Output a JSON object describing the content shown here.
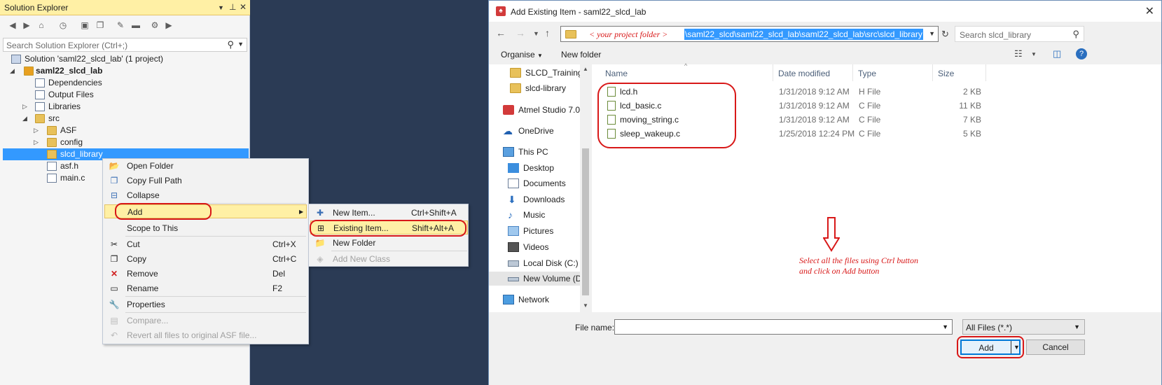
{
  "solution_explorer": {
    "title": "Solution Explorer",
    "search_placeholder": "Search Solution Explorer (Ctrl+;)",
    "tree": [
      {
        "label": "Solution 'saml22_slcd_lab' (1 project)"
      },
      {
        "label": "saml22_slcd_lab"
      },
      {
        "label": "Dependencies"
      },
      {
        "label": "Output Files"
      },
      {
        "label": "Libraries"
      },
      {
        "label": "src"
      },
      {
        "label": "ASF"
      },
      {
        "label": "config"
      },
      {
        "label": "slcd_library"
      },
      {
        "label": "asf.h"
      },
      {
        "label": "main.c"
      }
    ]
  },
  "context_menu": {
    "items": [
      {
        "label": "Open Folder",
        "shortcut": ""
      },
      {
        "label": "Copy Full Path",
        "shortcut": ""
      },
      {
        "label": "Collapse",
        "shortcut": ""
      },
      {
        "label": "Add",
        "shortcut": ""
      },
      {
        "label": "Scope to This",
        "shortcut": ""
      },
      {
        "label": "Cut",
        "shortcut": "Ctrl+X"
      },
      {
        "label": "Copy",
        "shortcut": "Ctrl+C"
      },
      {
        "label": "Remove",
        "shortcut": "Del"
      },
      {
        "label": "Rename",
        "shortcut": "F2"
      },
      {
        "label": "Properties",
        "shortcut": ""
      },
      {
        "label": "Compare...",
        "shortcut": ""
      },
      {
        "label": "Revert all files to original ASF file...",
        "shortcut": ""
      }
    ]
  },
  "add_submenu": {
    "items": [
      {
        "label": "New Item...",
        "shortcut": "Ctrl+Shift+A"
      },
      {
        "label": "Existing Item...",
        "shortcut": "Shift+Alt+A"
      },
      {
        "label": "New Folder",
        "shortcut": ""
      },
      {
        "label": "Add New Class",
        "shortcut": ""
      }
    ]
  },
  "dialog": {
    "title": "Add Existing Item - saml22_slcd_lab",
    "address_hint": "< your project folder >",
    "address_path": "\\saml22_slcd\\saml22_slcd_lab\\saml22_slcd_lab\\src\\slcd_library",
    "search_placeholder": "Search slcd_library",
    "organise": "Organise",
    "new_folder": "New folder",
    "nav_items": [
      {
        "label": "SLCD_Training_r"
      },
      {
        "label": "slcd-library"
      },
      {
        "label": "Atmel Studio 7.0"
      },
      {
        "label": "OneDrive"
      },
      {
        "label": "This PC"
      },
      {
        "label": "Desktop"
      },
      {
        "label": "Documents"
      },
      {
        "label": "Downloads"
      },
      {
        "label": "Music"
      },
      {
        "label": "Pictures"
      },
      {
        "label": "Videos"
      },
      {
        "label": "Local Disk (C:)"
      },
      {
        "label": "New Volume (D:"
      },
      {
        "label": "Network"
      }
    ],
    "columns": {
      "name": "Name",
      "date": "Date modified",
      "type": "Type",
      "size": "Size"
    },
    "files": [
      {
        "name": "lcd.h",
        "date": "1/31/2018 9:12 AM",
        "type": "H File",
        "size": "2 KB"
      },
      {
        "name": "lcd_basic.c",
        "date": "1/31/2018 9:12 AM",
        "type": "C File",
        "size": "11 KB"
      },
      {
        "name": "moving_string.c",
        "date": "1/31/2018 9:12 AM",
        "type": "C File",
        "size": "7 KB"
      },
      {
        "name": "sleep_wakeup.c",
        "date": "1/25/2018 12:24 PM",
        "type": "C File",
        "size": "5 KB"
      }
    ],
    "annotation_line1": "Select  all the files using Ctrl button",
    "annotation_line2": "and click on Add button",
    "file_name_label": "File name:",
    "file_name_value": "",
    "file_type": "All Files (*.*)",
    "add_button": "Add",
    "cancel_button": "Cancel"
  },
  "colors": {
    "highlight": "#3399ff",
    "annotation": "#d81818",
    "menu_hot": "#fff0a5",
    "background": "#2b3b55"
  }
}
